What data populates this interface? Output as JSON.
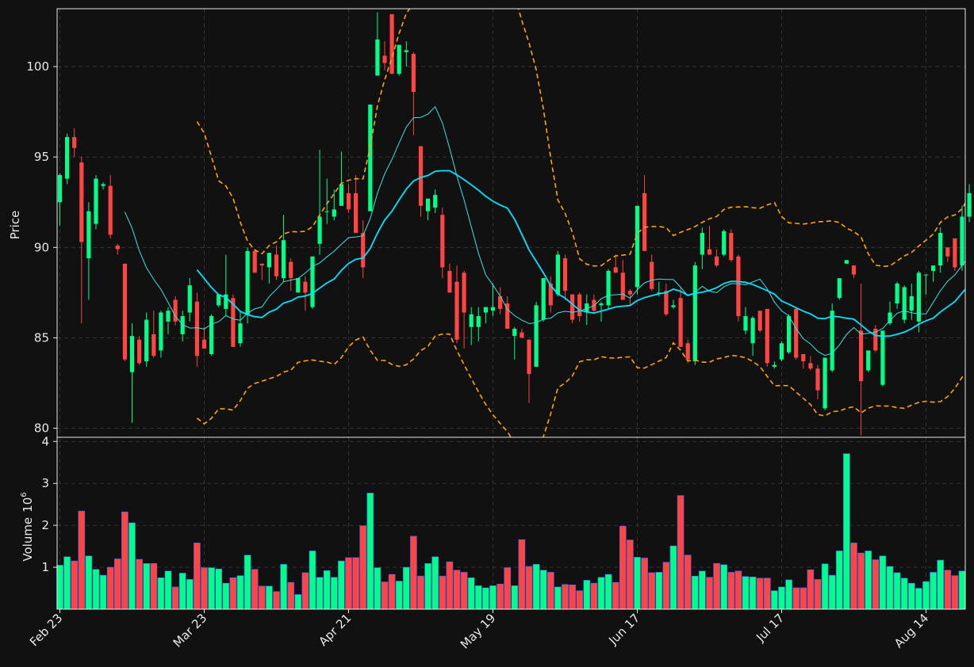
{
  "chart_data": {
    "type": "candlestick",
    "price_panel": {
      "ylabel": "Price",
      "ylim": [
        79.5,
        103.2
      ],
      "yticks": [
        80,
        85,
        90,
        95,
        100
      ],
      "grid": true
    },
    "volume_panel": {
      "ylabel": "Volume",
      "ylabel_exponent": "6",
      "ylim": [
        0.0,
        4.1
      ],
      "yticks": [
        1,
        2,
        3,
        4
      ],
      "grid": true
    },
    "xtick_labels": [
      {
        "index": 0,
        "label": "Feb 23"
      },
      {
        "index": 20,
        "label": "Mar 23"
      },
      {
        "index": 40,
        "label": "Apr 21"
      },
      {
        "index": 60,
        "label": "May 19"
      },
      {
        "index": 80,
        "label": "Jun 17"
      },
      {
        "index": 100,
        "label": "Jul 17"
      },
      {
        "index": 120,
        "label": "Aug 14"
      }
    ],
    "colors": {
      "up": "#00ff88",
      "down": "#ff4444",
      "volume_edge": "#4466ff",
      "fast_ma": "#40e0e0",
      "slow_ma": "#00e5ff",
      "bands": "#ffa500",
      "background": "#111111",
      "grid": "#3a3a3a",
      "text": "#e8e8e8"
    },
    "ohlc": [
      [
        92.5,
        94.1,
        91.2,
        94.0
      ],
      [
        93.8,
        96.3,
        93.5,
        96.1
      ],
      [
        96.1,
        96.6,
        95.0,
        95.5
      ],
      [
        94.7,
        95.0,
        85.8,
        90.3
      ],
      [
        89.4,
        92.5,
        87.1,
        92.0
      ],
      [
        91.3,
        94.0,
        91.0,
        93.8
      ],
      [
        93.4,
        93.6,
        93.2,
        93.5
      ],
      [
        93.4,
        94.0,
        90.5,
        90.7
      ],
      [
        90.1,
        90.2,
        89.6,
        89.9
      ],
      [
        89.1,
        89.1,
        83.7,
        83.8
      ],
      [
        83.1,
        85.8,
        80.3,
        85.1
      ],
      [
        84.9,
        85.1,
        83.5,
        83.6
      ],
      [
        83.7,
        86.4,
        83.4,
        86.0
      ],
      [
        85.2,
        86.5,
        83.9,
        84.0
      ],
      [
        84.3,
        86.5,
        83.9,
        86.4
      ],
      [
        85.9,
        86.7,
        85.2,
        86.5
      ],
      [
        87.1,
        87.3,
        85.7,
        85.9
      ],
      [
        85.2,
        86.5,
        84.8,
        86.2
      ],
      [
        86.4,
        88.3,
        85.9,
        87.9
      ],
      [
        87.0,
        87.5,
        83.4,
        84.0
      ],
      [
        84.9,
        85.6,
        84.4,
        84.4
      ],
      [
        84.1,
        86.3,
        84.0,
        86.2
      ],
      [
        86.8,
        87.3,
        86.7,
        87.4
      ],
      [
        86.6,
        89.6,
        86.2,
        87.4
      ],
      [
        87.2,
        87.4,
        84.5,
        84.5
      ],
      [
        84.7,
        86.5,
        84.5,
        85.8
      ],
      [
        86.3,
        90.0,
        85.8,
        89.8
      ],
      [
        89.8,
        89.9,
        88.6,
        88.6
      ],
      [
        89.1,
        89.1,
        88.2,
        89.0
      ],
      [
        88.9,
        89.7,
        88.0,
        89.7
      ],
      [
        89.6,
        90.1,
        88.2,
        88.4
      ],
      [
        88.3,
        91.8,
        88.1,
        90.4
      ],
      [
        89.2,
        89.4,
        87.6,
        88.3
      ],
      [
        87.5,
        88.3,
        87.5,
        88.3
      ],
      [
        88.1,
        88.4,
        86.5,
        87.5
      ],
      [
        86.7,
        89.5,
        86.6,
        89.5
      ],
      [
        90.2,
        95.4,
        89.6,
        91.7
      ],
      [
        92.0,
        93.8,
        91.3,
        92.0
      ],
      [
        91.7,
        93.2,
        91.5,
        92.1
      ],
      [
        92.3,
        95.3,
        92.3,
        93.5
      ],
      [
        93.0,
        93.5,
        91.9,
        92.1
      ],
      [
        93.0,
        94.0,
        92.4,
        90.8
      ],
      [
        90.8,
        91.5,
        88.3,
        88.9
      ],
      [
        92.0,
        97.9,
        92.0,
        97.9
      ],
      [
        99.5,
        103.0,
        99.5,
        101.5
      ],
      [
        100.6,
        101.4,
        99.8,
        100.2
      ],
      [
        102.9,
        102.9,
        99.9,
        99.6
      ],
      [
        99.6,
        101.2,
        99.5,
        101.2
      ],
      [
        100.8,
        101.4,
        100.0,
        100.9
      ],
      [
        100.7,
        100.8,
        96.2,
        98.6
      ],
      [
        95.6,
        95.6,
        91.7,
        92.3
      ],
      [
        92.0,
        92.7,
        91.5,
        92.7
      ],
      [
        92.2,
        93.2,
        91.9,
        92.9
      ],
      [
        91.8,
        92.2,
        88.3,
        88.9
      ],
      [
        88.7,
        89.1,
        87.5,
        87.5
      ],
      [
        88.1,
        89.0,
        84.7,
        84.9
      ],
      [
        88.6,
        88.7,
        84.4,
        86.4
      ],
      [
        85.6,
        86.7,
        84.6,
        86.3
      ],
      [
        85.6,
        86.7,
        84.8,
        86.2
      ],
      [
        86.4,
        86.7,
        85.8,
        86.7
      ],
      [
        86.5,
        88.0,
        86.2,
        86.7
      ],
      [
        87.3,
        87.8,
        86.3,
        86.6
      ],
      [
        86.9,
        87.3,
        85.5,
        85.5
      ],
      [
        85.1,
        85.6,
        83.8,
        85.5
      ],
      [
        85.3,
        85.5,
        85.0,
        85.0
      ],
      [
        84.9,
        84.9,
        81.4,
        83.0
      ],
      [
        83.4,
        87.0,
        83.4,
        86.8
      ],
      [
        86.0,
        88.3,
        85.9,
        88.3
      ],
      [
        88.0,
        88.4,
        86.4,
        86.8
      ],
      [
        87.4,
        89.8,
        87.3,
        89.6
      ],
      [
        89.4,
        89.6,
        87.1,
        87.6
      ],
      [
        87.4,
        87.4,
        85.8,
        86.0
      ],
      [
        87.4,
        87.5,
        85.9,
        86.2
      ],
      [
        86.4,
        87.4,
        85.7,
        86.9
      ],
      [
        87.1,
        87.4,
        86.3,
        86.5
      ],
      [
        86.8,
        87.0,
        85.9,
        86.9
      ],
      [
        86.8,
        88.8,
        86.6,
        88.7
      ],
      [
        88.9,
        89.6,
        88.6,
        88.6
      ],
      [
        88.6,
        89.3,
        87.3,
        87.1
      ],
      [
        87.6,
        87.7,
        86.8,
        87.4
      ],
      [
        87.8,
        92.3,
        87.4,
        92.3
      ],
      [
        93.0,
        94.0,
        89.8,
        89.8
      ],
      [
        89.2,
        89.6,
        87.6,
        87.7
      ],
      [
        87.5,
        88.1,
        87.3,
        87.5
      ],
      [
        87.6,
        88.0,
        86.2,
        86.3
      ],
      [
        86.7,
        87.1,
        86.6,
        86.8
      ],
      [
        87.2,
        87.8,
        84.5,
        84.5
      ],
      [
        84.7,
        84.9,
        83.6,
        83.8
      ],
      [
        83.7,
        89.2,
        83.5,
        89.0
      ],
      [
        89.6,
        91.1,
        88.8,
        90.8
      ],
      [
        89.9,
        91.2,
        89.6,
        89.6
      ],
      [
        89.5,
        89.9,
        88.9,
        89.0
      ],
      [
        89.6,
        91.0,
        89.5,
        90.9
      ],
      [
        90.8,
        91.0,
        89.2,
        89.3
      ],
      [
        89.5,
        89.6,
        85.9,
        86.2
      ],
      [
        85.4,
        86.7,
        85.2,
        86.2
      ],
      [
        84.7,
        86.2,
        84.0,
        86.1
      ],
      [
        86.5,
        86.5,
        85.3,
        85.4
      ],
      [
        86.6,
        86.6,
        83.4,
        83.6
      ],
      [
        83.4,
        83.7,
        83.3,
        83.5
      ],
      [
        83.8,
        84.8,
        83.7,
        84.7
      ],
      [
        84.2,
        86.3,
        84.1,
        86.2
      ],
      [
        86.6,
        86.7,
        83.8,
        83.9
      ],
      [
        84.1,
        84.1,
        83.3,
        83.7
      ],
      [
        83.6,
        84.0,
        83.2,
        83.3
      ],
      [
        83.3,
        83.5,
        81.6,
        82.1
      ],
      [
        81.1,
        83.9,
        81.0,
        83.9
      ],
      [
        83.2,
        86.9,
        83.1,
        86.5
      ],
      [
        87.2,
        87.9,
        87.1,
        88.3
      ],
      [
        89.1,
        89.3,
        89.1,
        89.3
      ],
      [
        89.0,
        89.0,
        88.3,
        88.5
      ],
      [
        85.4,
        88.0,
        79.6,
        82.6
      ],
      [
        83.2,
        84.3,
        83.1,
        84.3
      ],
      [
        85.5,
        85.7,
        84.2,
        84.3
      ],
      [
        82.4,
        85.4,
        82.3,
        85.4
      ],
      [
        85.8,
        87.0,
        85.7,
        86.4
      ],
      [
        86.9,
        88.1,
        86.6,
        88.0
      ],
      [
        86.0,
        87.9,
        85.8,
        87.8
      ],
      [
        86.5,
        88.0,
        86.0,
        87.3
      ],
      [
        85.9,
        88.7,
        85.3,
        88.6
      ],
      [
        88.5,
        88.5,
        87.4,
        88.5
      ],
      [
        88.7,
        89.0,
        88.1,
        89.0
      ],
      [
        89.0,
        91.1,
        88.6,
        90.8
      ],
      [
        90.0,
        90.0,
        89.2,
        89.5
      ],
      [
        90.5,
        90.5,
        88.7,
        88.9
      ],
      [
        89.0,
        92.3,
        88.7,
        91.7
      ],
      [
        91.7,
        93.5,
        91.4,
        93.0
      ],
      [
        92.8,
        94.0,
        92.6,
        93.7
      ]
    ],
    "volume": [
      1.05,
      1.25,
      1.15,
      2.34,
      1.27,
      0.95,
      0.81,
      1.0,
      1.2,
      2.32,
      2.06,
      1.19,
      1.09,
      1.09,
      0.75,
      0.91,
      0.53,
      0.86,
      0.71,
      1.58,
      0.99,
      0.99,
      0.96,
      0.62,
      0.75,
      0.8,
      1.29,
      0.95,
      0.55,
      0.55,
      0.42,
      1.07,
      0.64,
      0.35,
      0.87,
      1.39,
      0.76,
      0.92,
      0.76,
      1.15,
      1.23,
      1.23,
      1.99,
      2.77,
      0.99,
      0.65,
      0.83,
      0.67,
      1.0,
      1.74,
      0.79,
      1.09,
      1.25,
      0.79,
      1.13,
      0.93,
      0.88,
      0.75,
      0.56,
      0.51,
      0.56,
      0.6,
      0.99,
      0.56,
      1.66,
      1.02,
      1.07,
      0.93,
      0.88,
      0.53,
      0.59,
      0.58,
      0.44,
      0.69,
      0.62,
      0.76,
      0.83,
      0.64,
      1.98,
      1.65,
      1.24,
      1.22,
      0.87,
      0.88,
      1.12,
      1.51,
      2.71,
      1.29,
      0.79,
      0.91,
      0.76,
      1.09,
      1.06,
      0.88,
      0.91,
      0.78,
      0.77,
      0.74,
      0.74,
      0.44,
      0.53,
      0.7,
      0.51,
      0.51,
      0.94,
      0.71,
      1.08,
      0.81,
      1.39,
      3.71,
      1.58,
      1.34,
      1.39,
      1.18,
      1.27,
      1.02,
      0.87,
      0.74,
      0.62,
      0.5,
      0.66,
      0.88,
      1.17,
      0.93,
      0.8,
      0.91
    ]
  }
}
